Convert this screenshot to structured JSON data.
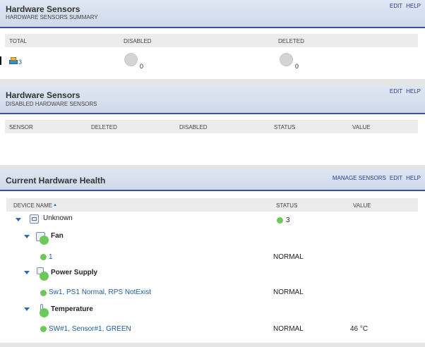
{
  "panel1": {
    "title": "Hardware Sensors",
    "subtitle": "HARDWARE SENSORS SUMMARY",
    "actions": {
      "edit": "EDIT",
      "help": "HELP"
    },
    "columns": {
      "total": "TOTAL",
      "disabled": "DISABLED",
      "deleted": "DELETED"
    },
    "values": {
      "total": "3",
      "disabled": "0",
      "deleted": "0"
    }
  },
  "panel2": {
    "title": "Hardware Sensors",
    "subtitle": "DISABLED HARDWARE SENSORS",
    "actions": {
      "edit": "EDIT",
      "help": "HELP"
    },
    "columns": {
      "sensor": "SENSOR",
      "deleted": "DELETED",
      "disabled": "DISABLED",
      "status": "STATUS",
      "value": "VALUE"
    }
  },
  "panel3": {
    "title": "Current Hardware Health",
    "actions": {
      "manage": "MANAGE SENSORS",
      "edit": "EDIT",
      "help": "HELP"
    },
    "columns": {
      "device": "DEVICE NAME",
      "sort": "▲",
      "status": "STATUS",
      "value": "VALUE"
    },
    "tree": {
      "device": {
        "name": "Unknown",
        "status": "3"
      },
      "fan": {
        "name": "Fan",
        "items": [
          {
            "name": "1",
            "status": "NORMAL",
            "value": ""
          }
        ]
      },
      "power": {
        "name": "Power Supply",
        "items": [
          {
            "name": "Sw1, PS1 Normal, RPS NotExist",
            "status": "NORMAL",
            "value": ""
          }
        ]
      },
      "temp": {
        "name": "Temperature",
        "items": [
          {
            "name": "SW#1, Sensor#1, GREEN",
            "status": "NORMAL",
            "value": "46 °C"
          }
        ]
      }
    }
  },
  "colors": {
    "accent": "#3b4f9a",
    "status_ok": "#6ac95a",
    "link": "#1c5c98"
  }
}
